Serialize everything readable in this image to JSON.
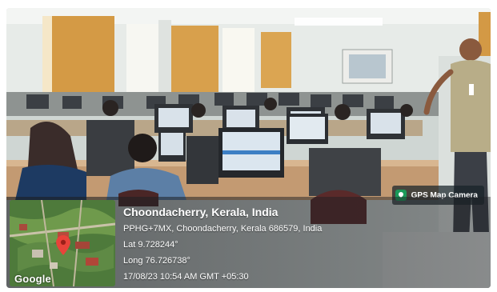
{
  "photo": {
    "description_icon": "classroom-photo",
    "colors": {
      "curtain": "#d9a24a",
      "wall": "#eef1ee",
      "desk": "#c9a27a",
      "monitor_bezel": "#2a2d31",
      "screen": "#dde7ef"
    }
  },
  "badge": {
    "icon": "gps-map-camera-icon",
    "label": "GPS Map Camera"
  },
  "map": {
    "attribution": "Google"
  },
  "location": {
    "title": "Choondacherry, Kerala, India",
    "address": "PPHG+7MX, Choondacherry, Kerala 686579, India",
    "lat": "Lat 9.728244°",
    "long": "Long 76.726738°",
    "datetime": "17/08/23 10:54 AM GMT +05:30"
  }
}
